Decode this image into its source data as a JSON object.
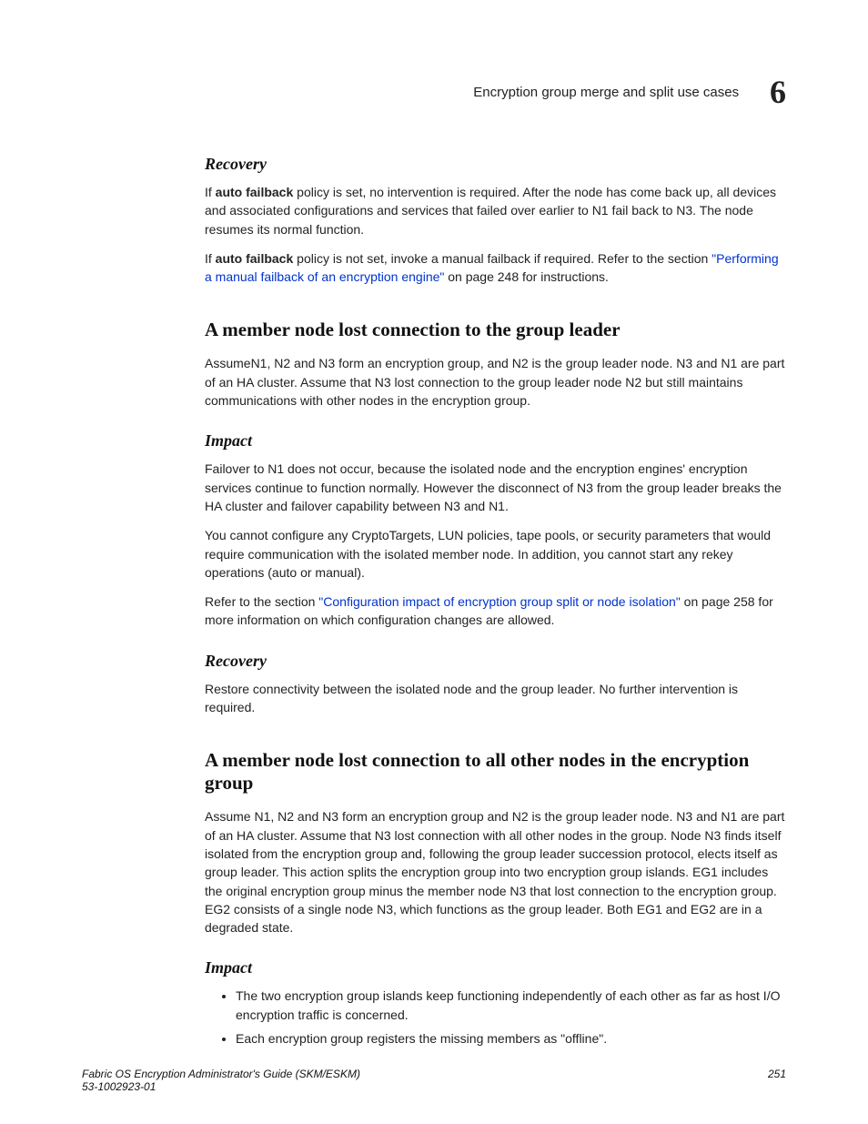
{
  "header": {
    "title": "Encryption group merge and split use cases",
    "chapter": "6"
  },
  "recovery1": {
    "heading": "Recovery",
    "para1_lead": "If ",
    "para1_bold": "auto failback",
    "para1_rest": " policy is set, no intervention is required. After the node has come back up, all devices and associated configurations and services that failed over earlier to N1 fail back to N3. The node resumes its normal function.",
    "para2_lead": "If ",
    "para2_bold": "auto failback",
    "para2_mid": " policy is not set, invoke a manual failback if required. Refer to the section ",
    "para2_link": "\"Performing a manual failback of an encryption engine\"",
    "para2_rest": " on page 248 for instructions."
  },
  "section1": {
    "heading": "A member node lost connection to the group leader",
    "para1": "AssumeN1, N2 and N3 form an encryption group, and N2 is the group leader node. N3 and N1 are part of an HA cluster. Assume that N3 lost connection to the group leader node N2 but still maintains communications with other nodes in the encryption group.",
    "impact_heading": "Impact",
    "impact_p1": "Failover to N1 does not occur, because the isolated node and the encryption engines' encryption services continue to function normally. However the disconnect of N3 from the group leader breaks the HA cluster and failover capability between N3 and N1.",
    "impact_p2": "You cannot configure any CryptoTargets, LUN policies, tape pools, or security parameters that would require communication with the isolated member node. In addition, you cannot start any rekey operations (auto or manual).",
    "impact_p3_lead": "Refer to the section ",
    "impact_p3_link": "\"Configuration impact of encryption group split or node isolation\"",
    "impact_p3_rest": " on page 258 for more information on which configuration changes are allowed.",
    "recovery_heading": "Recovery",
    "recovery_p": "Restore connectivity between the isolated node and the group leader. No further intervention is required."
  },
  "section2": {
    "heading": "A member node lost connection to all other nodes in the encryption group",
    "para1": "Assume N1, N2 and N3 form an encryption group and N2 is the group leader node. N3 and N1 are part of an HA cluster. Assume that N3 lost connection with all other nodes in the group. Node N3 finds itself isolated from the encryption group and, following the group leader succession protocol, elects itself as group leader. This action splits the encryption group into two encryption group islands. EG1 includes the original encryption group minus the member node N3 that lost connection to the encryption group. EG2 consists of a single node N3, which functions as the group leader. Both EG1 and EG2 are in a degraded state.",
    "impact_heading": "Impact",
    "bullet1": "The two encryption group islands keep functioning independently of each other as far as host I/O encryption traffic is concerned.",
    "bullet2": "Each encryption group registers the missing members as \"offline\"."
  },
  "footer": {
    "line1": "Fabric OS Encryption Administrator's Guide (SKM/ESKM)",
    "line2": "53-1002923-01",
    "page": "251"
  }
}
